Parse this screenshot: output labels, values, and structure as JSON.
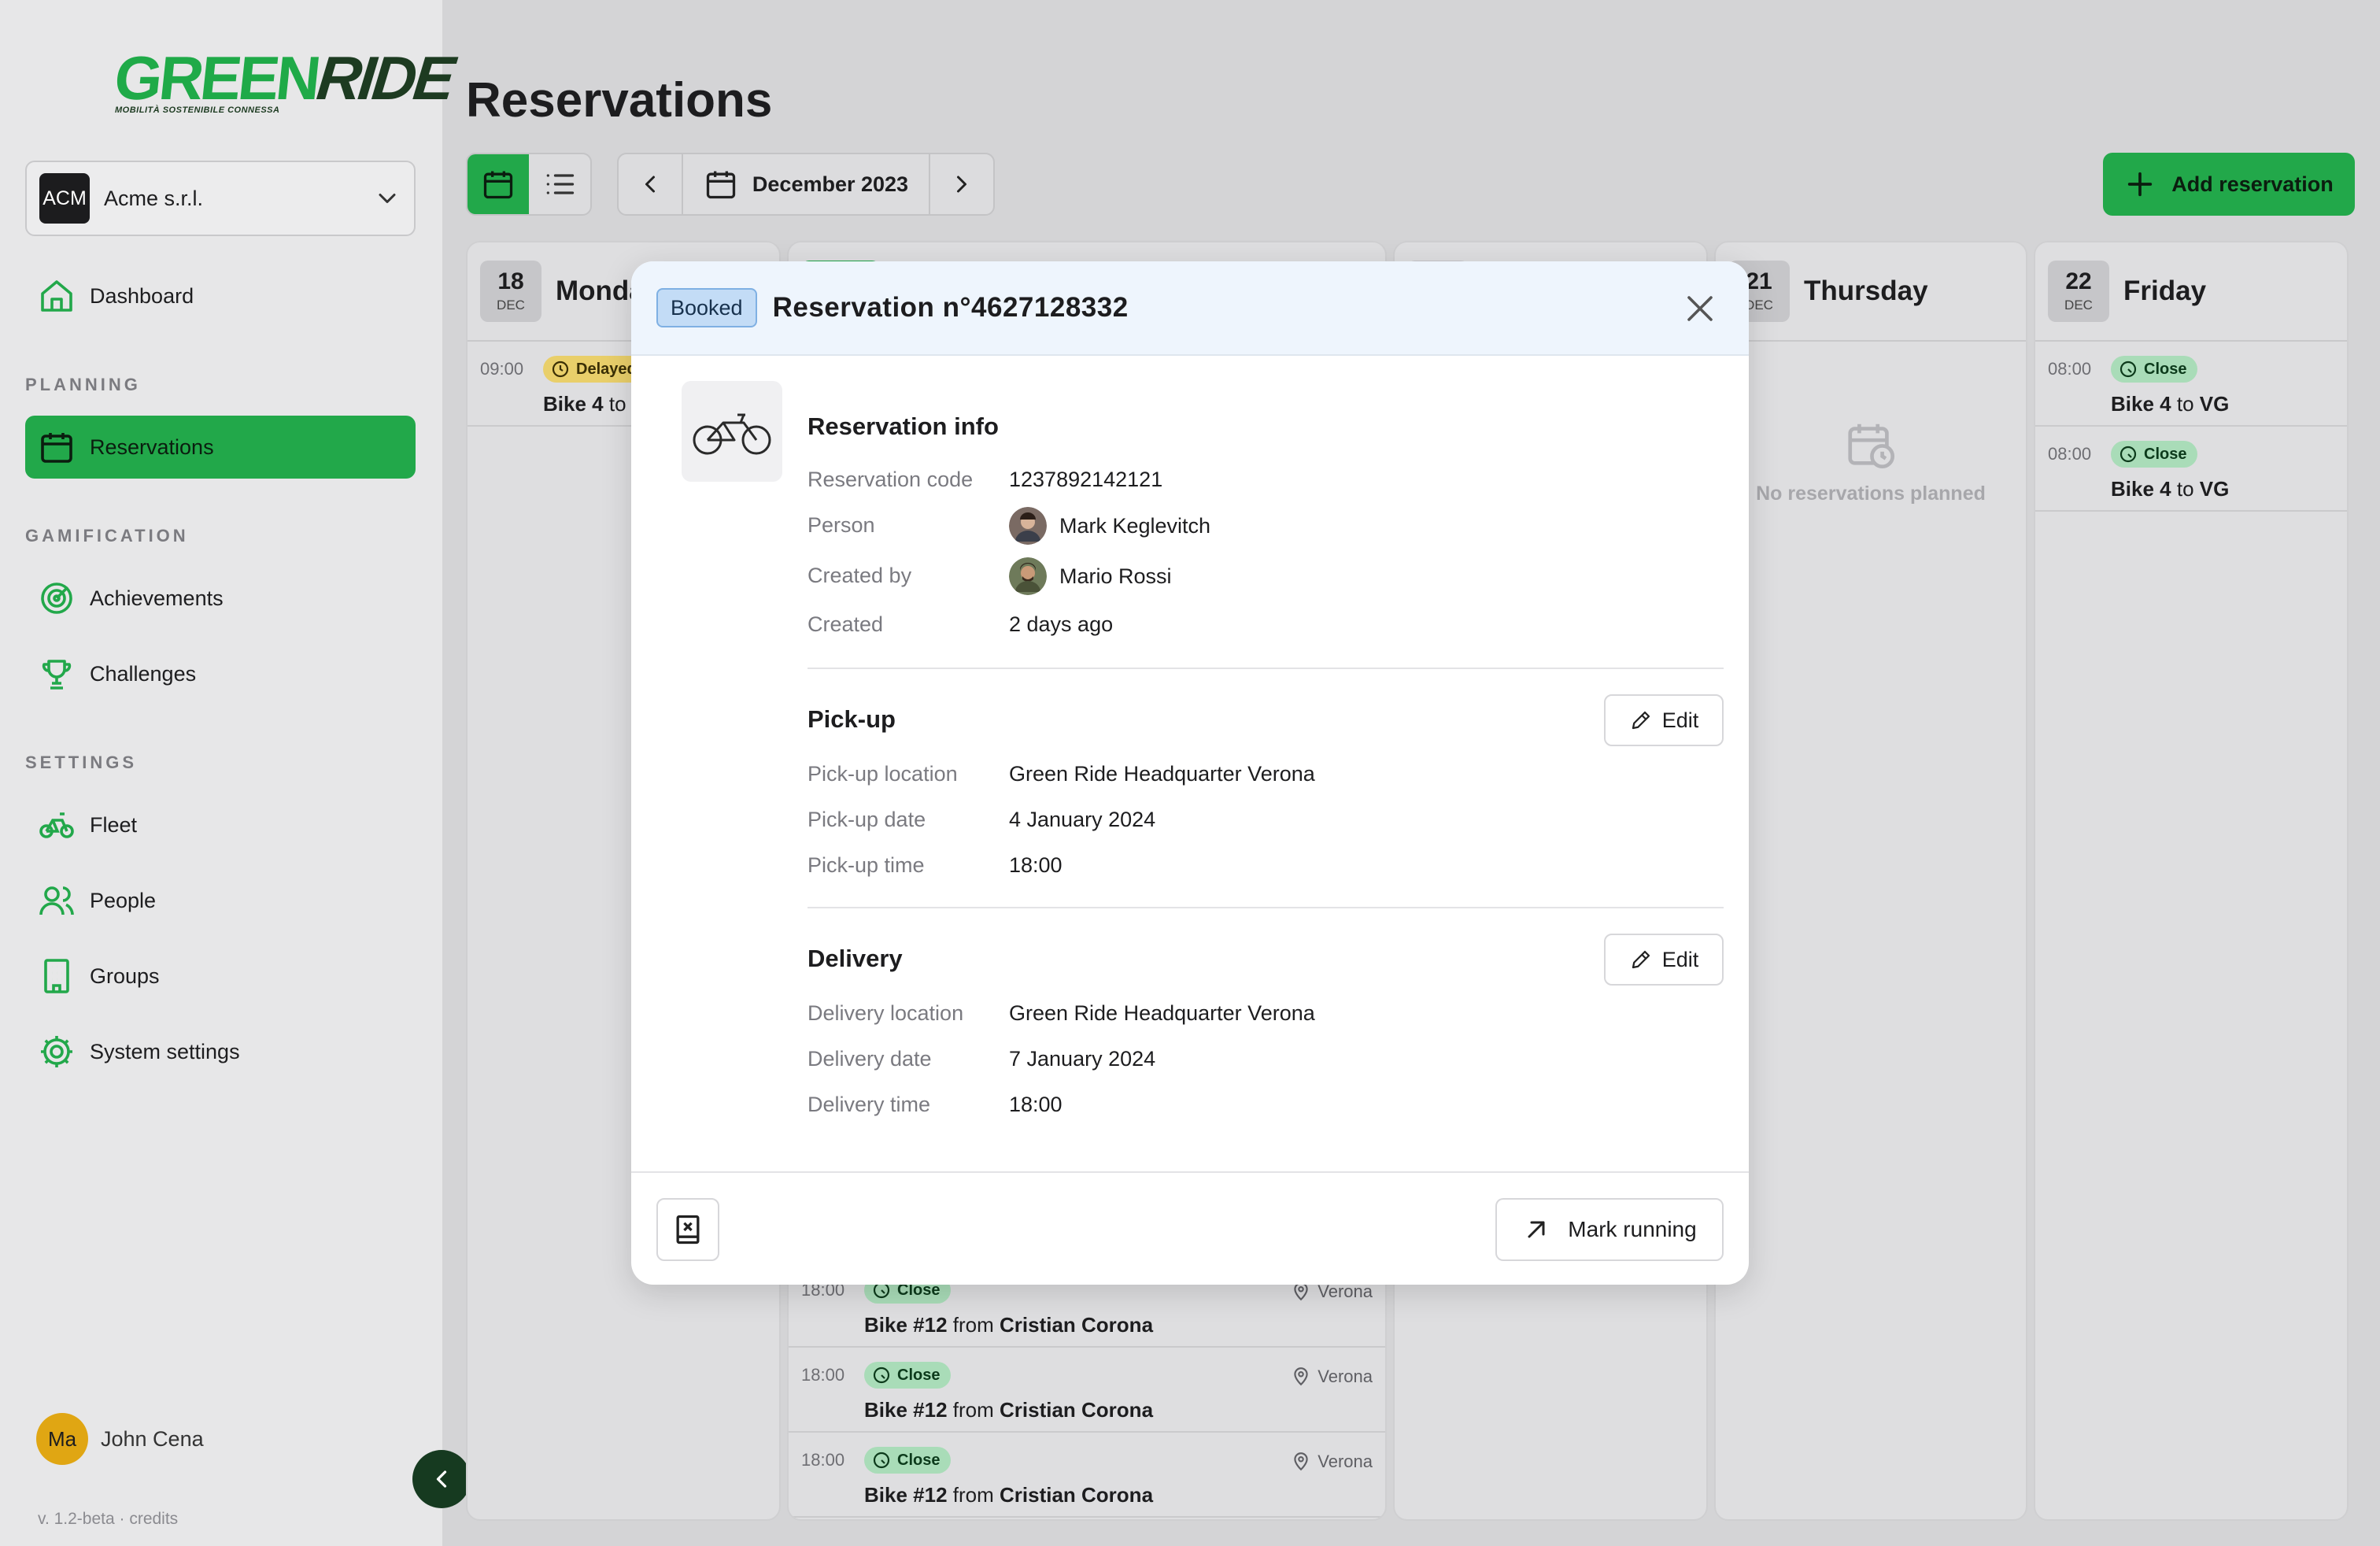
{
  "brand": {
    "logo_green": "GREEN",
    "logo_dark": "RIDE",
    "tagline": "MOBILITÀ SOSTENIBILE CONNESSA"
  },
  "org": {
    "badge": "ACM",
    "name": "Acme s.r.l."
  },
  "nav": {
    "dashboard": "Dashboard",
    "planning_label": "PLANNING",
    "reservations": "Reservations",
    "gamification_label": "GAMIFICATION",
    "achievements": "Achievements",
    "challenges": "Challenges",
    "settings_label": "SETTINGS",
    "fleet": "Fleet",
    "people": "People",
    "groups": "Groups",
    "system_settings": "System settings"
  },
  "user": {
    "initials": "Ma",
    "name": "John Cena"
  },
  "version": "v. 1.2-beta · credits",
  "page": {
    "title": "Reservations",
    "month": "December 2023",
    "add_label": "Add reservation"
  },
  "days": {
    "mon": {
      "num": "18",
      "month": "DEC",
      "name": "Monday",
      "res": {
        "time": "09:00",
        "status": "Delayed",
        "bike": "Bike 4",
        "to": "to"
      }
    },
    "tue": {
      "items": [
        {
          "time": "18:00",
          "status": "Close",
          "bike": "Bike #12",
          "from": "from",
          "person": "Cristian Corona",
          "loc": "Verona"
        },
        {
          "time": "18:00",
          "status": "Close",
          "bike": "Bike #12",
          "from": "from",
          "person": "Cristian Corona",
          "loc": "Verona"
        },
        {
          "time": "18:00",
          "status": "Close",
          "bike": "Bike #12",
          "from": "from",
          "person": "Cristian Corona",
          "loc": "Verona"
        }
      ]
    },
    "thu": {
      "num": "21",
      "month": "DEC",
      "name": "Thursday",
      "empty": "No reservations planned"
    },
    "fri": {
      "num": "22",
      "month": "DEC",
      "name": "Friday",
      "items": [
        {
          "time": "08:00",
          "status": "Close",
          "bike": "Bike 4",
          "to": "to",
          "dest": "VG"
        },
        {
          "time": "08:00",
          "status": "Close",
          "bike": "Bike 4",
          "to": "to",
          "dest": "VG"
        }
      ]
    }
  },
  "modal": {
    "badge": "Booked",
    "title": "Reservation n°4627128332",
    "info_title": "Reservation info",
    "code_label": "Reservation code",
    "code": "1237892142121",
    "person_label": "Person",
    "person": "Mark Keglevitch",
    "created_by_label": "Created by",
    "created_by": "Mario Rossi",
    "created_label": "Created",
    "created": "2 days ago",
    "pickup_title": "Pick-up",
    "pickup_location_label": "Pick-up location",
    "pickup_location": "Green Ride Headquarter Verona",
    "pickup_date_label": "Pick-up date",
    "pickup_date": "4 January 2024",
    "pickup_time_label": "Pick-up time",
    "pickup_time": "18:00",
    "delivery_title": "Delivery",
    "delivery_location_label": "Delivery location",
    "delivery_location": "Green Ride Headquarter Verona",
    "delivery_date_label": "Delivery date",
    "delivery_date": "7 January 2024",
    "delivery_time_label": "Delivery time",
    "delivery_time": "18:00",
    "edit_label": "Edit",
    "mark_label": "Mark running"
  },
  "colors": {
    "brand_green": "#22a84a",
    "brand_dark": "#1d3b21",
    "booked_blue": "#c3dcf6"
  },
  "icons": [
    "home-icon",
    "calendar-icon",
    "target-icon",
    "trophy-icon",
    "bike-icon",
    "people-icon",
    "building-icon",
    "gear-icon",
    "chevron-down-icon",
    "chevron-left-icon",
    "chevron-right-icon",
    "list-icon",
    "plus-icon",
    "close-icon",
    "pencil-icon",
    "arrow-up-right-icon",
    "book-x-icon",
    "map-pin-icon",
    "calendar-clock-icon"
  ]
}
